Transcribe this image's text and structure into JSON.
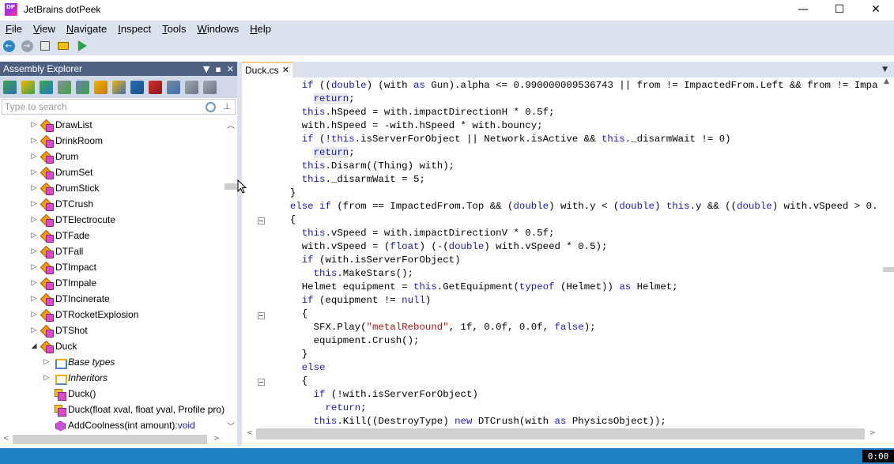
{
  "window": {
    "title": "JetBrains dotPeek",
    "app_icon_label": "DP",
    "minimize": "—",
    "maximize": "☐",
    "close": "✕"
  },
  "menu": [
    {
      "label": "File",
      "mnemonic": "F",
      "rest": "ile"
    },
    {
      "label": "View",
      "mnemonic": "V",
      "rest": "iew"
    },
    {
      "label": "Navigate",
      "mnemonic": "N",
      "rest": "avigate"
    },
    {
      "label": "Inspect",
      "mnemonic": "I",
      "rest": "nspect"
    },
    {
      "label": "Tools",
      "mnemonic": "T",
      "rest": "ools"
    },
    {
      "label": "Windows",
      "mnemonic": "W",
      "rest": "indows"
    },
    {
      "label": "Help",
      "mnemonic": "H",
      "rest": "elp"
    }
  ],
  "toolbar": {
    "back": "←",
    "forward": "→"
  },
  "explorer": {
    "title": "Assembly Explorer",
    "dropdown": "▼",
    "pin": "▪",
    "close": "✕",
    "search_placeholder": "Type to search",
    "tree": [
      {
        "label": "DrawList",
        "expanded": false
      },
      {
        "label": "DrinkRoom",
        "expanded": false
      },
      {
        "label": "Drum",
        "expanded": false
      },
      {
        "label": "DrumSet",
        "expanded": false
      },
      {
        "label": "DrumStick",
        "expanded": false
      },
      {
        "label": "DTCrush",
        "expanded": false
      },
      {
        "label": "DTElectrocute",
        "expanded": false
      },
      {
        "label": "DTFade",
        "expanded": false
      },
      {
        "label": "DTFall",
        "expanded": false
      },
      {
        "label": "DTImpact",
        "expanded": false
      },
      {
        "label": "DTImpale",
        "expanded": false
      },
      {
        "label": "DTIncinerate",
        "expanded": false
      },
      {
        "label": "DTRocketExplosion",
        "expanded": false
      },
      {
        "label": "DTShot",
        "expanded": false
      },
      {
        "label": "Duck",
        "expanded": true
      }
    ],
    "duck_children": [
      {
        "label": "Base types",
        "kind": "base"
      },
      {
        "label": "Inheritors",
        "kind": "inh"
      },
      {
        "label": "Duck()",
        "kind": "ctor"
      },
      {
        "label": "Duck(float xval, float yval, Profile pro)",
        "kind": "ctor"
      },
      {
        "label": "AddCoolness(int amount)",
        "ret": ":void",
        "kind": "meth"
      }
    ]
  },
  "editor": {
    "tab_label": "Duck.cs",
    "tab_close": "✕"
  },
  "status": {
    "time": "0:00"
  },
  "colors": {
    "accent": "#1f7fc4",
    "panel_header": "#4d6082",
    "keyword": "#1a1ab8",
    "string": "#a31515"
  }
}
